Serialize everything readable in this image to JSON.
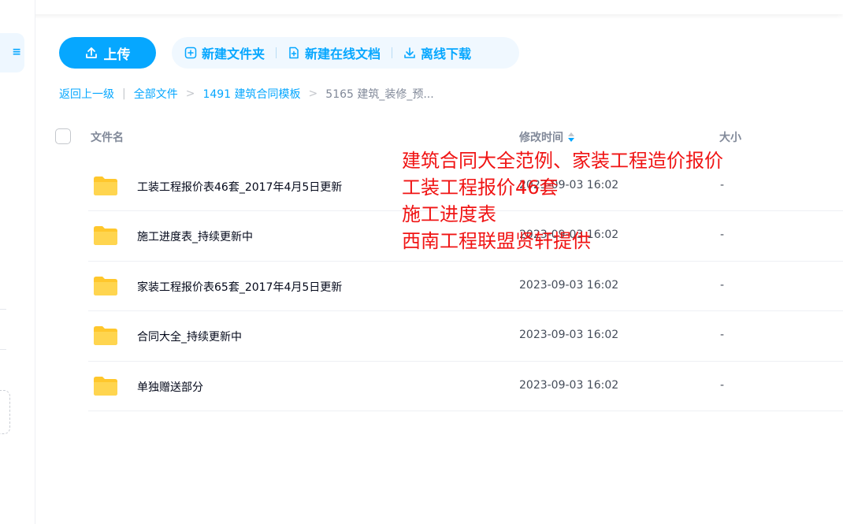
{
  "sidebar": {
    "active_icon": "list-icon"
  },
  "toolbar": {
    "upload_label": "上传",
    "new_folder_label": "新建文件夹",
    "new_doc_label": "新建在线文档",
    "offline_download_label": "离线下载"
  },
  "breadcrumb": {
    "back": "返回上一级",
    "separator": "|",
    "items": [
      "全部文件",
      "1491 建筑合同模板",
      "5165 建筑_装修_预..."
    ],
    "arrow": ">"
  },
  "table": {
    "columns": {
      "name": "文件名",
      "time": "修改时间",
      "size": "大小"
    },
    "rows": [
      {
        "name": "工装工程报价表46套_2017年4月5日更新",
        "time": "2023-09-03 16:02",
        "size": "-"
      },
      {
        "name": "施工进度表_持续更新中",
        "time": "2023-09-03 16:02",
        "size": "-"
      },
      {
        "name": "家装工程报价表65套_2017年4月5日更新",
        "time": "2023-09-03 16:02",
        "size": "-"
      },
      {
        "name": "合同大全_持续更新中",
        "time": "2023-09-03 16:02",
        "size": "-"
      },
      {
        "name": "单独赠送部分",
        "time": "2023-09-03 16:02",
        "size": "-"
      }
    ]
  },
  "overlay_text": {
    "lines": [
      "建筑合同大全范例、家装工程造价报价",
      "工装工程报价46套",
      "施工进度表",
      "西南工程联盟贤轩提供"
    ]
  },
  "colors": {
    "accent": "#06a7ff",
    "overlay": "#f01414",
    "folder": "#ffc72c"
  }
}
